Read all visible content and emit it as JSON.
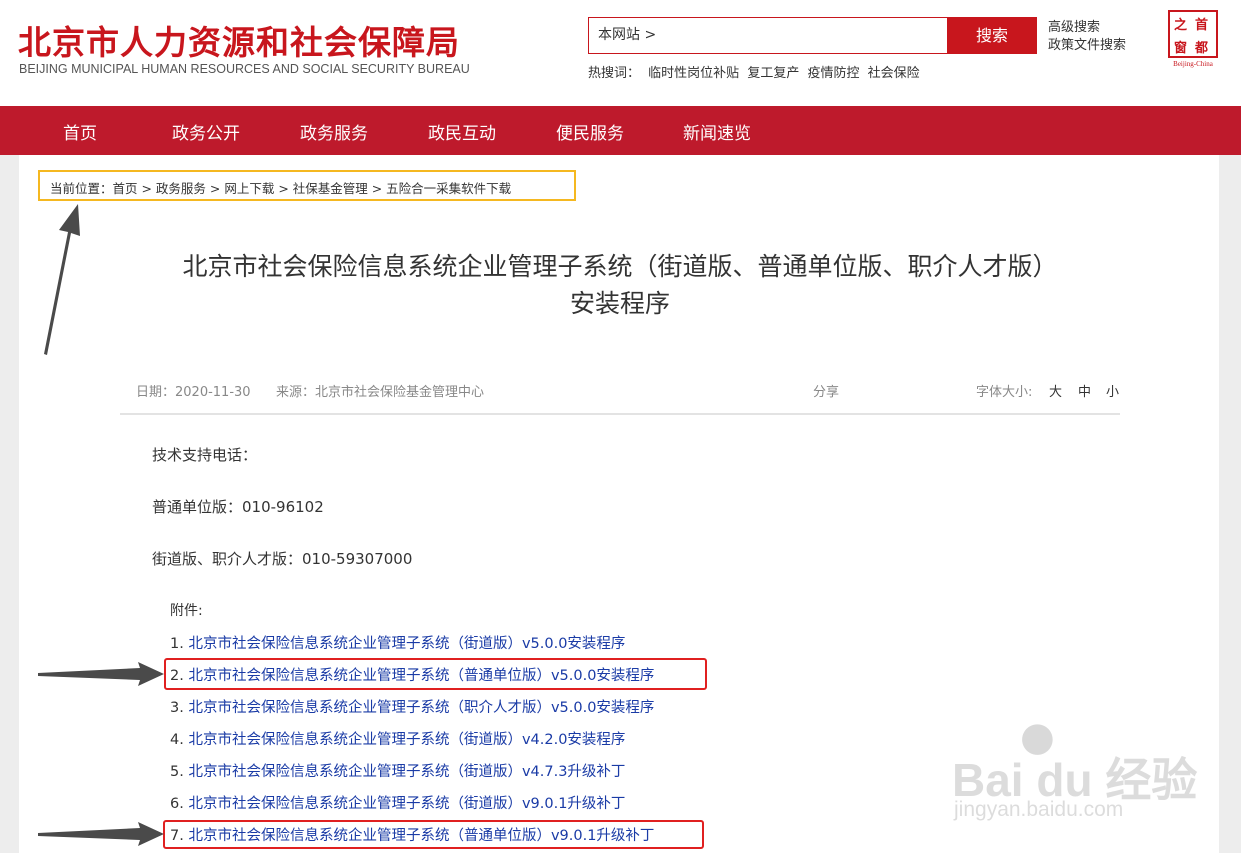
{
  "header": {
    "logo_cn": "北京市人力资源和社会保障局",
    "logo_en": "BEIJING MUNICIPAL HUMAN RESOURCES AND SOCIAL SECURITY BUREAU",
    "search_scope": "本网站 >",
    "search_button": "搜索",
    "advanced_search": "高级搜索",
    "policy_search": "政策文件搜索",
    "hot_label": "热搜词：",
    "hot_words": [
      "临时性岗位补贴",
      "复工复产",
      "疫情防控",
      "社会保险"
    ],
    "seal_chars": [
      "之",
      "首",
      "窗",
      "都"
    ],
    "seal_en": "Beijing-China"
  },
  "nav": {
    "items": [
      "首页",
      "政务公开",
      "政务服务",
      "政民互动",
      "便民服务",
      "新闻速览"
    ]
  },
  "breadcrumb": "当前位置：首页 > 政务服务 > 网上下载 > 社保基金管理 > 五险合一采集软件下载",
  "article": {
    "title_line1": "北京市社会保险信息系统企业管理子系统（街道版、普通单位版、职介人才版）",
    "title_line2": "安装程序",
    "date": "日期：2020-11-30",
    "source": "来源：北京市社会保险基金管理中心",
    "share": "分享",
    "font_size_label": "字体大小:",
    "font_sizes": [
      "大",
      "中",
      "小"
    ],
    "support_label": "技术支持电话：",
    "phone_normal": "普通单位版：010-96102",
    "phone_street": "街道版、职介人才版：010-59307000",
    "attachments_label": "附件:",
    "attachments": [
      {
        "num": "1.",
        "label": "北京市社会保险信息系统企业管理子系统（街道版）v5.0.0安装程序"
      },
      {
        "num": "2.",
        "label": "北京市社会保险信息系统企业管理子系统（普通单位版）v5.0.0安装程序"
      },
      {
        "num": "3.",
        "label": "北京市社会保险信息系统企业管理子系统（职介人才版）v5.0.0安装程序"
      },
      {
        "num": "4.",
        "label": "北京市社会保险信息系统企业管理子系统（街道版）v4.2.0安装程序"
      },
      {
        "num": "5.",
        "label": "北京市社会保险信息系统企业管理子系统（街道版）v4.7.3升级补丁"
      },
      {
        "num": "6.",
        "label": "北京市社会保险信息系统企业管理子系统（街道版）v9.0.1升级补丁"
      },
      {
        "num": "7.",
        "label": "北京市社会保险信息系统企业管理子系统（普通单位版）v9.0.1升级补丁"
      }
    ]
  },
  "watermark": {
    "text": "Bai du 经验",
    "sub": "jingyan.baidu.com"
  },
  "colors": {
    "brand_red": "#c8161d",
    "nav_red": "#be1a2c",
    "link_blue": "#1a3ba6",
    "highlight_yellow": "#f5b820",
    "highlight_red": "#e02020"
  }
}
